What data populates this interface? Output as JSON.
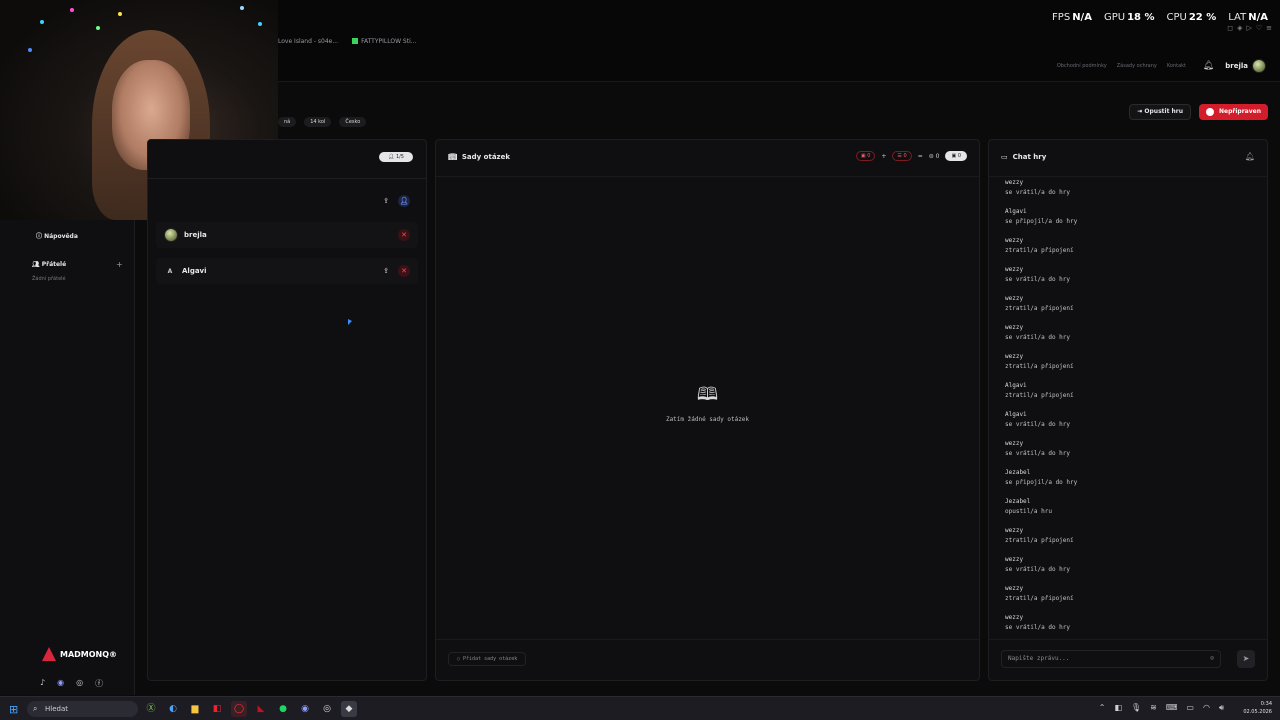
{
  "browser_tabs": [
    "Love Island - s04e...",
    "FATTYPILLOW Sti..."
  ],
  "perf": [
    {
      "label": "FPS",
      "value": "N/A"
    },
    {
      "label": "GPU",
      "value": "18 %"
    },
    {
      "label": "CPU",
      "value": "22 %"
    },
    {
      "label": "LAT",
      "value": "N/A"
    }
  ],
  "header": {
    "links": [
      "Obchodní podmínky",
      "Zásady ochrany",
      "Kontakt"
    ],
    "username": "brejla"
  },
  "game_pills": [
    "ná",
    "14 kol",
    "Česko"
  ],
  "actions": {
    "leave": "Opustit hru",
    "ready": "Nepřipraven"
  },
  "sidebar": {
    "help": "Nápověda",
    "friends": "Přátelé",
    "friends_empty": "Žádní přátelé",
    "brand": "MADMONQ®"
  },
  "players": {
    "count": "1/5",
    "list": [
      {
        "initial": "",
        "name": "brejla"
      },
      {
        "initial": "A",
        "name": "Algavi"
      }
    ]
  },
  "sets": {
    "title": "Sady otázek",
    "stats": [
      "0",
      "0",
      "0"
    ],
    "stat_pill": "0",
    "empty_text": "Zatím žádné sady otázek",
    "add_label": "Přidat sady otázek"
  },
  "chat": {
    "title": "Chat hry",
    "messages": [
      {
        "who": "wezzy",
        "what": "se vrátil/a do hry"
      },
      {
        "who": "Algavi",
        "what": "se připojil/a do hry"
      },
      {
        "who": "wezzy",
        "what": "ztratil/a připojení"
      },
      {
        "who": "wezzy",
        "what": "se vrátil/a do hry"
      },
      {
        "who": "wezzy",
        "what": "ztratil/a připojení"
      },
      {
        "who": "wezzy",
        "what": "se vrátil/a do hry"
      },
      {
        "who": "wezzy",
        "what": "ztratil/a připojení"
      },
      {
        "who": "Algavi",
        "what": "ztratil/a připojení"
      },
      {
        "who": "Algavi",
        "what": "se vrátil/a do hry"
      },
      {
        "who": "wezzy",
        "what": "se vrátil/a do hry"
      },
      {
        "who": "Jezabel",
        "what": "se připojil/a do hry"
      },
      {
        "who": "Jezabel",
        "what": "opustil/a hru"
      },
      {
        "who": "wezzy",
        "what": "ztratil/a připojení"
      },
      {
        "who": "wezzy",
        "what": "se vrátil/a do hry"
      },
      {
        "who": "wezzy",
        "what": "ztratil/a připojení"
      },
      {
        "who": "wezzy",
        "what": "se vrátil/a do hry"
      }
    ],
    "placeholder": "Napište zprávu..."
  },
  "taskbar": {
    "search": "Hledat",
    "time": "0:34",
    "date": "02.05.2026"
  }
}
